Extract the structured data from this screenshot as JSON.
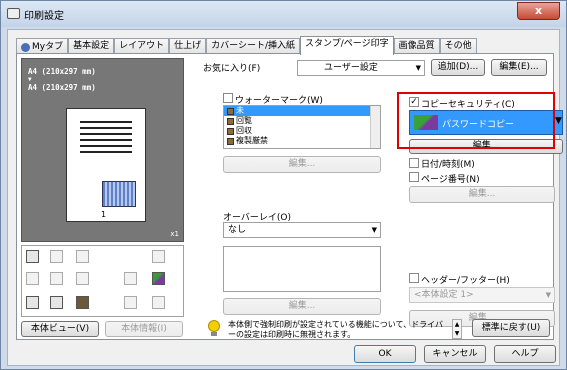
{
  "window": {
    "title": "印刷設定",
    "close": "x"
  },
  "tabs": [
    "Myタブ",
    "基本設定",
    "レイアウト",
    "仕上げ",
    "カバーシート/挿入紙",
    "スタンプ/ページ印字",
    "画像品質",
    "その他"
  ],
  "preview": {
    "line1": "A4 (210x297 mm)",
    "arrow": "▼",
    "line2": "A4 (210x297 mm)",
    "zoom": "x1",
    "page_number": "1"
  },
  "bottom_left": {
    "printer_view": "本体ビュー(V)",
    "printer_info": "本体情報(I)"
  },
  "favorites": {
    "label": "お気に入り(F)",
    "value": "ユーザー設定",
    "add": "追加(D)...",
    "edit": "編集(E)..."
  },
  "watermark": {
    "label": "ウォーターマーク(W)",
    "items": [
      "未",
      "回覧",
      "回収",
      "複製厳禁"
    ],
    "edit": "編集..."
  },
  "overlay": {
    "label": "オーバーレイ(O)",
    "value": "なし",
    "edit": "編集..."
  },
  "copy_security": {
    "label": "コピーセキュリティ(C)",
    "value": "パスワードコピー",
    "edit": "編集..."
  },
  "datetime": {
    "label": "日付/時刻(M)"
  },
  "page_number": {
    "label": "ページ番号(N)",
    "edit": "編集..."
  },
  "header_footer": {
    "label": "ヘッダー/フッター(H)",
    "value": "<本体設定 1>",
    "edit": "編集..."
  },
  "info": {
    "message": "本体側で強制印刷が設定されている機能について、ドライバーの設定は印刷時に無視されます。",
    "restore": "標準に戻す(U)"
  },
  "footer": {
    "ok": "OK",
    "cancel": "キャンセル",
    "help": "ヘルプ"
  }
}
